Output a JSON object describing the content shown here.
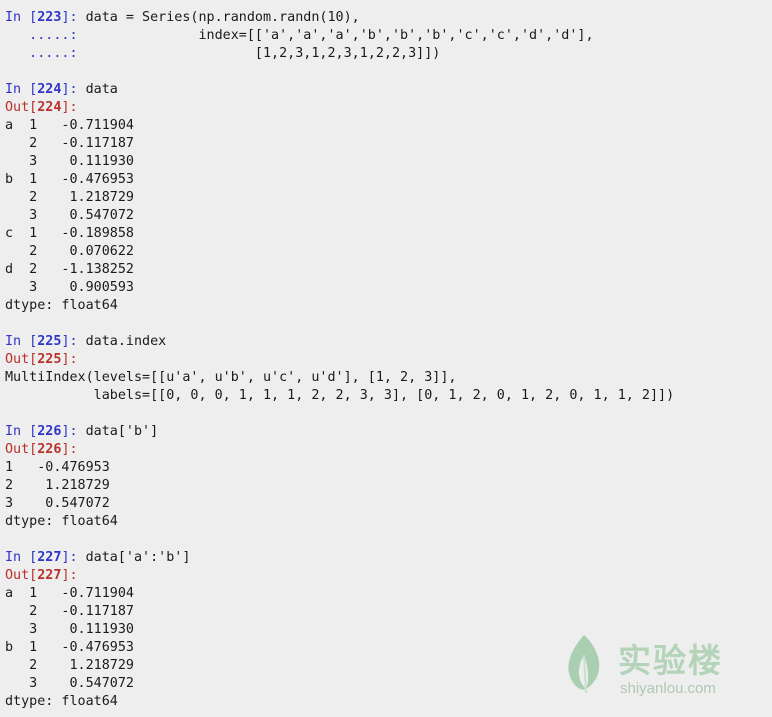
{
  "cells": [
    {
      "in_num": "223",
      "input": [
        "data = Series(np.random.randn(10),"
      ],
      "continuation": [
        "               index=[['a','a','a','b','b','b','c','c','d','d'],",
        "                      [1,2,3,1,2,3,1,2,2,3]])"
      ],
      "out_num": null,
      "output": []
    },
    {
      "in_num": "224",
      "input": [
        "data"
      ],
      "continuation": [],
      "out_num": "224",
      "output": [
        "a  1   -0.711904",
        "   2   -0.117187",
        "   3    0.111930",
        "b  1   -0.476953",
        "   2    1.218729",
        "   3    0.547072",
        "c  1   -0.189858",
        "   2    0.070622",
        "d  2   -1.138252",
        "   3    0.900593",
        "dtype: float64"
      ]
    },
    {
      "in_num": "225",
      "input": [
        "data.index"
      ],
      "continuation": [],
      "out_num": "225",
      "output": [
        "MultiIndex(levels=[[u'a', u'b', u'c', u'd'], [1, 2, 3]],",
        "           labels=[[0, 0, 0, 1, 1, 1, 2, 2, 3, 3], [0, 1, 2, 0, 1, 2, 0, 1, 1, 2]])"
      ]
    },
    {
      "in_num": "226",
      "input": [
        "data['b']"
      ],
      "continuation": [],
      "out_num": "226",
      "output": [
        "1   -0.476953",
        "2    1.218729",
        "3    0.547072",
        "dtype: float64"
      ]
    },
    {
      "in_num": "227",
      "input": [
        "data['a':'b']"
      ],
      "continuation": [],
      "out_num": "227",
      "output": [
        "a  1   -0.711904",
        "   2   -0.117187",
        "   3    0.111930",
        "b  1   -0.476953",
        "   2    1.218729",
        "   3    0.547072",
        "dtype: float64"
      ]
    }
  ],
  "prompts": {
    "in_prefix": "In [",
    "out_prefix": "Out[",
    "close": "]:",
    "continuation": "   .....:"
  },
  "watermark": {
    "title": "实验楼",
    "url": "shiyanlou.com",
    "color": "#b4d4ba"
  },
  "colors": {
    "background": "#eeeeee",
    "in_prompt": "#2f35c6",
    "out_prompt": "#b8322a",
    "text": "#1b1b1b"
  }
}
